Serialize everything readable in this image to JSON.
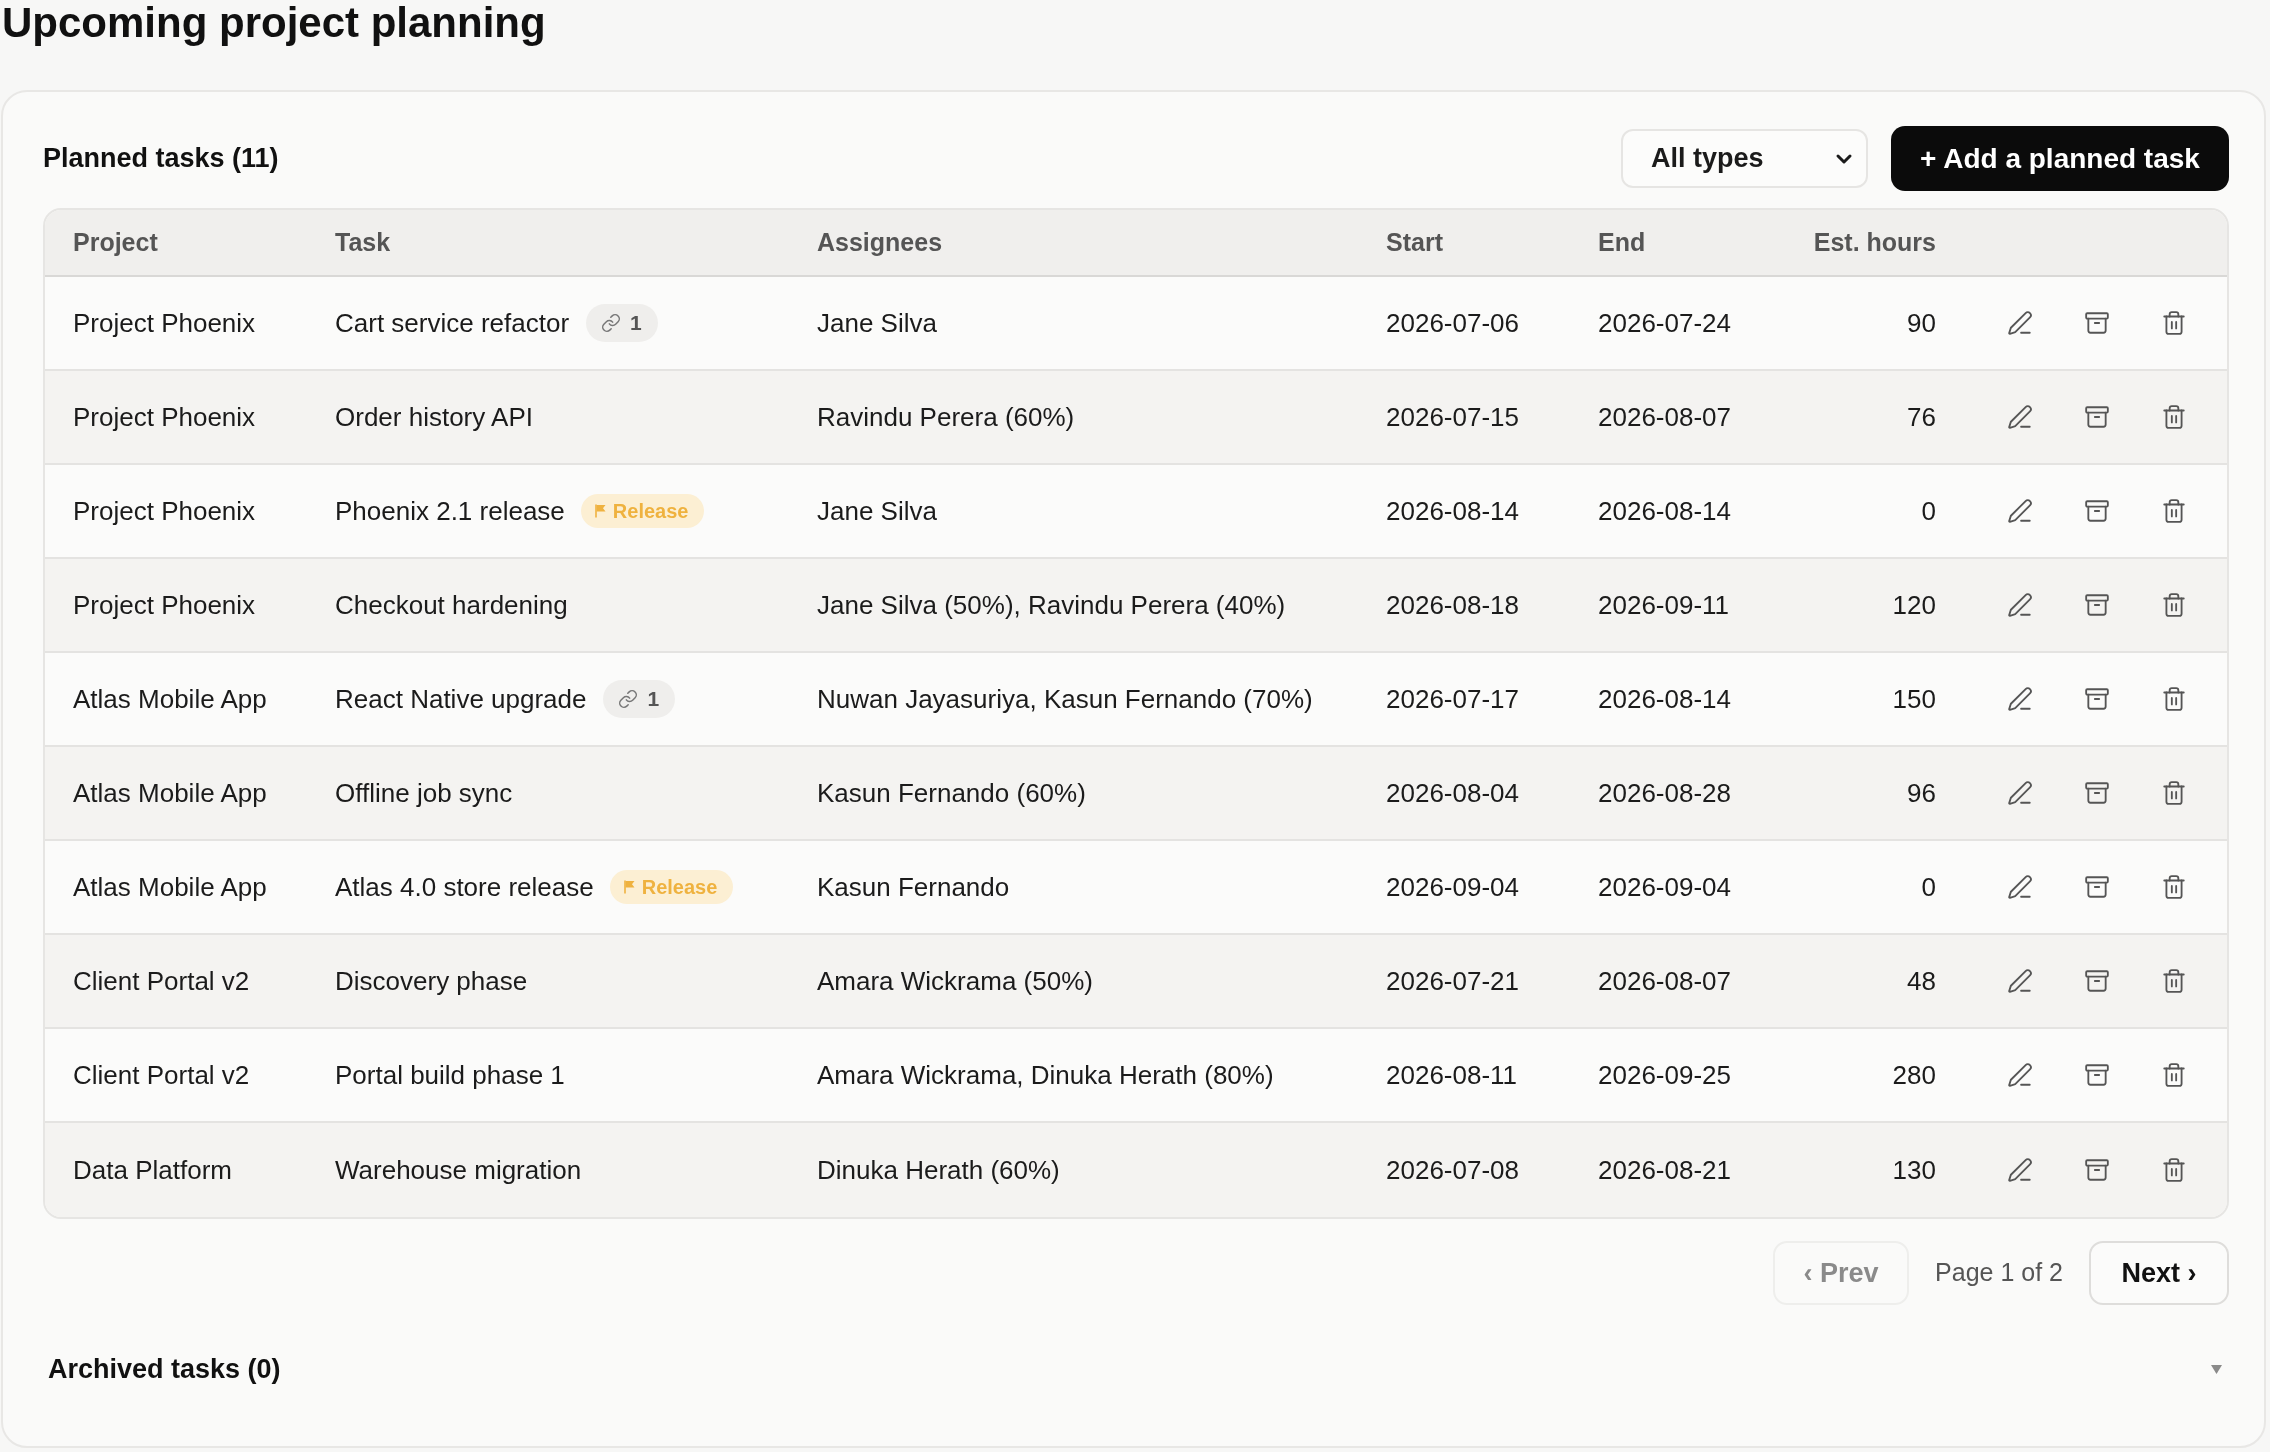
{
  "page": {
    "title": "Upcoming project planning"
  },
  "planned": {
    "title": "Planned tasks (11)",
    "filter": {
      "value": "All types"
    },
    "add_button": "+ Add a planned task",
    "table": {
      "columns": [
        "Project",
        "Task",
        "Assignees",
        "Start",
        "End",
        "Est. hours"
      ],
      "rows": [
        {
          "project": "Project Phoenix",
          "task": "Cart service refactor",
          "badge": {
            "kind": "links",
            "label": "1"
          },
          "assignees": "Jane Silva",
          "start": "2026-07-06",
          "end": "2026-07-24",
          "hours": "90"
        },
        {
          "project": "Project Phoenix",
          "task": "Order history API",
          "assignees": "Ravindu Perera (60%)",
          "start": "2026-07-15",
          "end": "2026-08-07",
          "hours": "76"
        },
        {
          "project": "Project Phoenix",
          "task": "Phoenix 2.1 release",
          "badge": {
            "kind": "release",
            "label": "Release"
          },
          "assignees": "Jane Silva",
          "start": "2026-08-14",
          "end": "2026-08-14",
          "hours": "0"
        },
        {
          "project": "Project Phoenix",
          "task": "Checkout hardening",
          "assignees": "Jane Silva (50%), Ravindu Perera (40%)",
          "start": "2026-08-18",
          "end": "2026-09-11",
          "hours": "120"
        },
        {
          "project": "Atlas Mobile App",
          "task": "React Native upgrade",
          "badge": {
            "kind": "links",
            "label": "1"
          },
          "assignees": "Nuwan Jayasuriya, Kasun Fernando (70%)",
          "start": "2026-07-17",
          "end": "2026-08-14",
          "hours": "150"
        },
        {
          "project": "Atlas Mobile App",
          "task": "Offline job sync",
          "assignees": "Kasun Fernando (60%)",
          "start": "2026-08-04",
          "end": "2026-08-28",
          "hours": "96"
        },
        {
          "project": "Atlas Mobile App",
          "task": "Atlas 4.0 store release",
          "badge": {
            "kind": "release",
            "label": "Release"
          },
          "assignees": "Kasun Fernando",
          "start": "2026-09-04",
          "end": "2026-09-04",
          "hours": "0"
        },
        {
          "project": "Client Portal v2",
          "task": "Discovery phase",
          "assignees": "Amara Wickrama (50%)",
          "start": "2026-07-21",
          "end": "2026-08-07",
          "hours": "48"
        },
        {
          "project": "Client Portal v2",
          "task": "Portal build phase 1",
          "assignees": "Amara Wickrama, Dinuka Herath (80%)",
          "start": "2026-08-11",
          "end": "2026-09-25",
          "hours": "280"
        },
        {
          "project": "Data Platform",
          "task": "Warehouse migration",
          "assignees": "Dinuka Herath (60%)",
          "start": "2026-07-08",
          "end": "2026-08-21",
          "hours": "130"
        }
      ]
    },
    "pagination": {
      "prev": {
        "label": "‹ Prev",
        "disabled": true
      },
      "page_label": "Page 1 of 2",
      "next": {
        "label": "Next ›",
        "disabled": false
      }
    }
  },
  "archived": {
    "title": "Archived tasks (0)",
    "expanded": false
  }
}
